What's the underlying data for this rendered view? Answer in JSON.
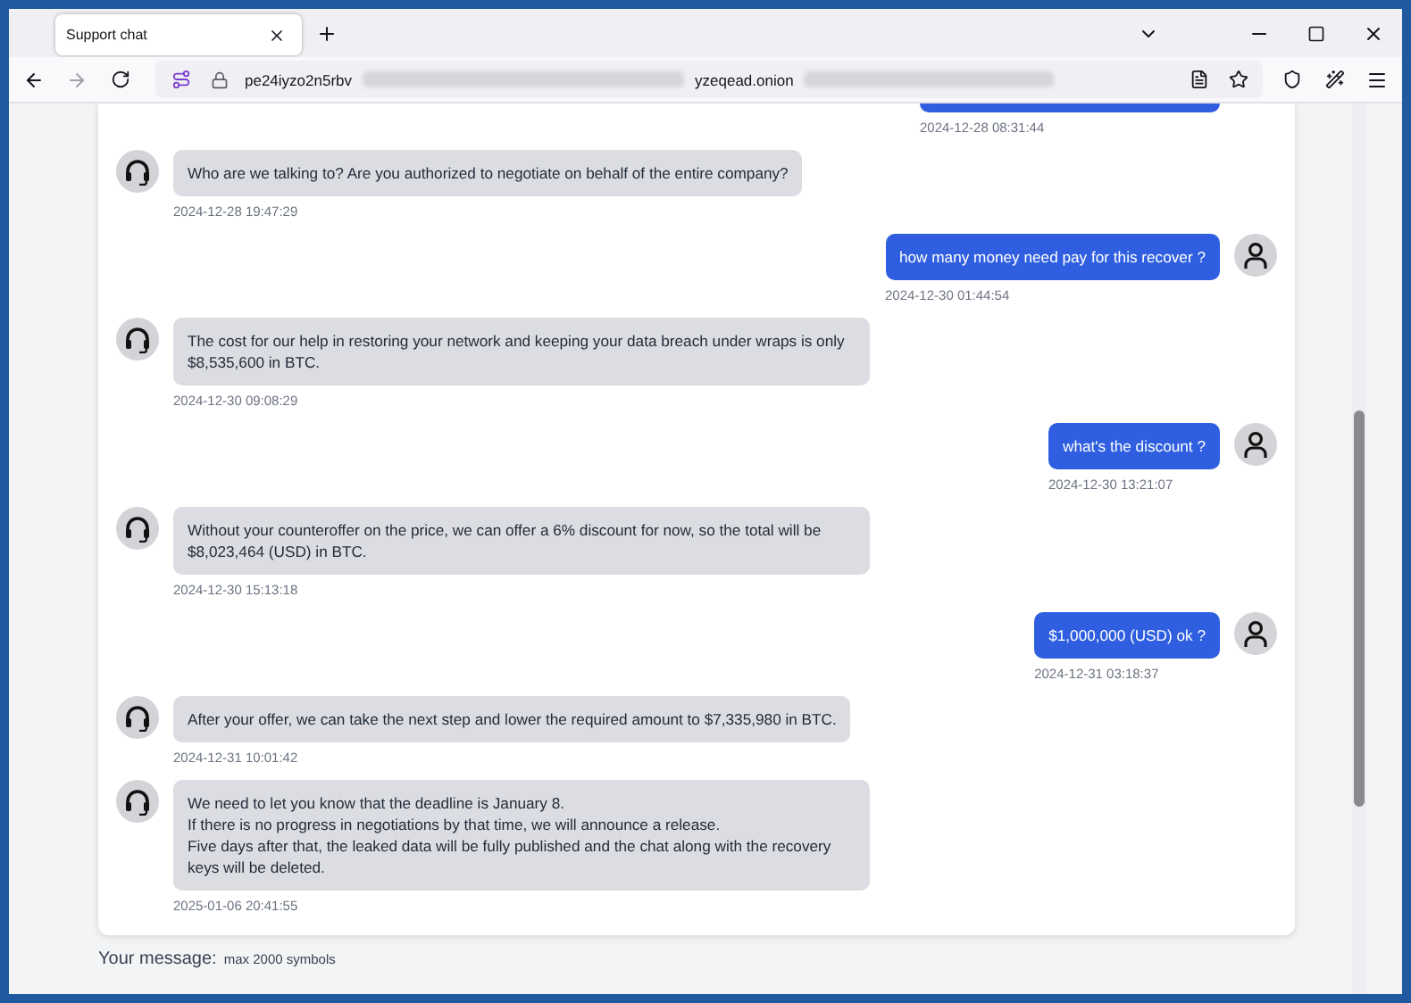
{
  "tab": {
    "title": "Support chat",
    "selected": true
  },
  "address": {
    "parts": [
      {
        "kind": "text",
        "text": "pe24iyzo2n5rbv"
      },
      {
        "kind": "redacted"
      },
      {
        "kind": "text",
        "text": "yzeqead.onion"
      },
      {
        "kind": "redacted"
      }
    ]
  },
  "messages": [
    {
      "kind": "user",
      "clipped": true,
      "time": "2024-12-28 08:31:44"
    },
    {
      "kind": "support",
      "text": "Who are we talking to? Are you authorized to negotiate on behalf of the entire company?",
      "time": "2024-12-28 19:47:29"
    },
    {
      "kind": "user",
      "text": "how many money need pay for this recover ?",
      "time": "2024-12-30 01:44:54"
    },
    {
      "kind": "support",
      "text": "The cost for our help in restoring your network and keeping your data breach under wraps is only $8,535,600 in BTC.",
      "time": "2024-12-30 09:08:29"
    },
    {
      "kind": "user",
      "text": "what's the discount ?",
      "time": "2024-12-30 13:21:07"
    },
    {
      "kind": "support",
      "text": "Without your counteroffer on the price, we can offer a 6% discount for now, so the total will be $8,023,464 (USD) in BTC.",
      "time": "2024-12-30 15:13:18"
    },
    {
      "kind": "user",
      "text": "$1,000,000 (USD) ok ?",
      "time": "2024-12-31 03:18:37"
    },
    {
      "kind": "support",
      "text": "After your offer, we can take the next step and lower the required amount to $7,335,980 in BTC.",
      "time": "2024-12-31 10:01:42"
    },
    {
      "kind": "support",
      "lines": [
        "We need to let you know that the deadline is January 8.",
        "If there is no progress in negotiations by that time, we will announce a release.",
        "Five days after that, the leaked data will be fully published and the chat along with the recovery keys will be deleted."
      ],
      "time": "2025-01-06 20:41:55"
    }
  ],
  "composer": {
    "label": "Your message:",
    "hint": "max 2000 symbols"
  }
}
